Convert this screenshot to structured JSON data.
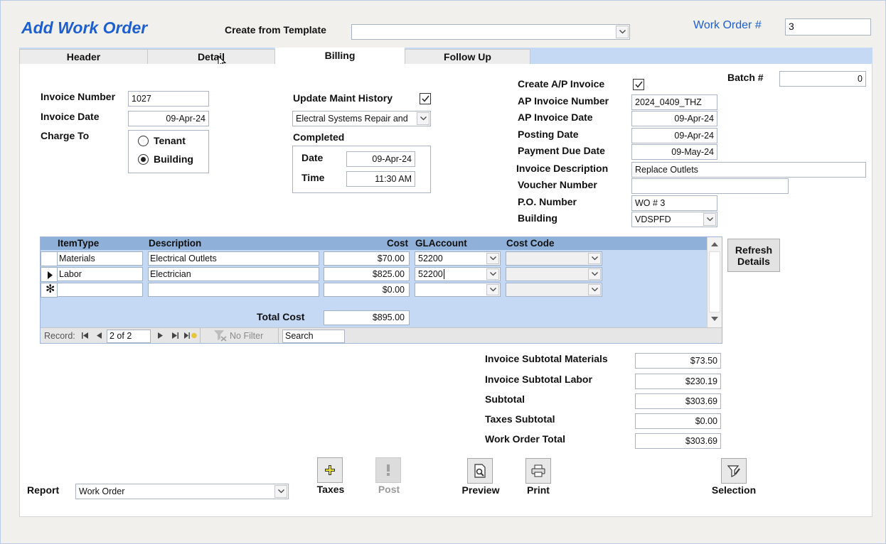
{
  "form": {
    "title": "Add Work Order",
    "template_label": "Create from Template",
    "template_value": "",
    "wo_label": "Work Order #",
    "wo_value": "3"
  },
  "tabs": [
    {
      "label": "Header"
    },
    {
      "label": "Detail"
    },
    {
      "label": "Billing",
      "active": true
    },
    {
      "label": "Follow Up"
    }
  ],
  "billing": {
    "invoice_number_label": "Invoice Number",
    "invoice_number": "1027",
    "invoice_date_label": "Invoice Date",
    "invoice_date": "09-Apr-24",
    "charge_to_label": "Charge To",
    "charge_options": [
      "Tenant",
      "Building"
    ],
    "charge_selected": "Building",
    "update_history_label": "Update Maint History",
    "update_history_checked": true,
    "history_type": "Electral Systems Repair and",
    "completed_label": "Completed",
    "date_label": "Date",
    "date_value": "09-Apr-24",
    "time_label": "Time",
    "time_value": "11:30 AM",
    "create_ap_label": "Create A/P Invoice",
    "create_ap_checked": true,
    "batch_label": "Batch #",
    "batch_value": "0",
    "ap_invoice_number_label": "AP Invoice Number",
    "ap_invoice_number": "2024_0409_THZ",
    "ap_invoice_date_label": "AP Invoice Date",
    "ap_invoice_date": "09-Apr-24",
    "posting_date_label": "Posting Date",
    "posting_date": "09-Apr-24",
    "payment_due_label": "Payment Due Date",
    "payment_due": "09-May-24",
    "invoice_desc_label": "Invoice Description",
    "invoice_desc": "Replace Outlets",
    "voucher_label": "Voucher Number",
    "voucher_value": "",
    "po_label": "P.O. Number",
    "po_value": "WO # 3",
    "building_label": "Building",
    "building_value": "VDSPFD"
  },
  "grid": {
    "columns": [
      "ItemType",
      "Description",
      "Cost",
      "GLAccount",
      "Cost Code"
    ],
    "rows": [
      {
        "item_type": "Materials",
        "description": "Electrical Outlets",
        "cost": "$70.00",
        "gl_account": "52200",
        "cost_code": ""
      },
      {
        "item_type": "Labor",
        "description": "Electrician",
        "cost": "$825.00",
        "gl_account": "52200",
        "cost_code": ""
      },
      {
        "item_type": "",
        "description": "",
        "cost": "$0.00",
        "gl_account": "",
        "cost_code": ""
      }
    ],
    "total_label": "Total Cost",
    "total_value": "$895.00",
    "nav": {
      "record_label": "Record:",
      "position": "2 of 2",
      "filter_label": "No Filter",
      "search_text": "Search"
    }
  },
  "refresh_button": "Refresh Details",
  "totals": {
    "materials_label": "Invoice Subtotal Materials",
    "materials_value": "$73.50",
    "labor_label": "Invoice Subtotal Labor",
    "labor_value": "$230.19",
    "subtotal_label": "Subtotal",
    "subtotal_value": "$303.69",
    "taxes_label": "Taxes Subtotal",
    "taxes_value": "$0.00",
    "total_label": "Work Order Total",
    "total_value": "$303.69"
  },
  "footer": {
    "report_label": "Report",
    "report_value": "Work Order",
    "taxes_label": "Taxes",
    "post_label": "Post",
    "preview_label": "Preview",
    "print_label": "Print",
    "selection_label": "Selection"
  },
  "colors": {
    "title_blue": "#1e5fd0",
    "tab_strip": "#c5d9f5",
    "grid_header": "#8fb0d9"
  }
}
